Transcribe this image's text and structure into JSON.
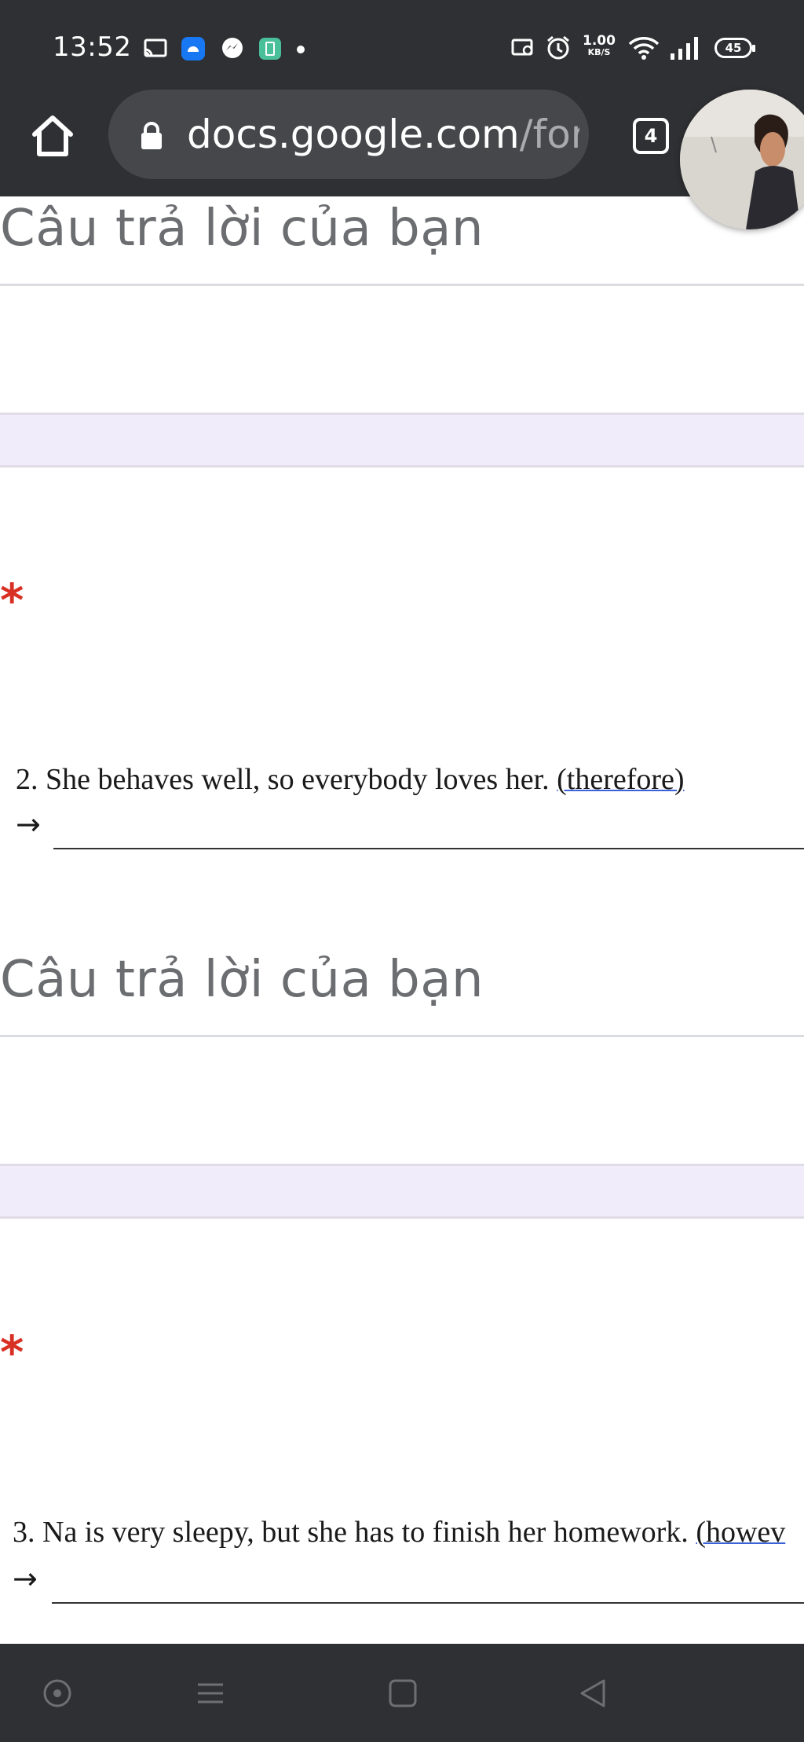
{
  "status_bar": {
    "time": "13:52",
    "net_speed_value": "1.00",
    "net_speed_unit": "KB/S",
    "battery": "45",
    "notification_icons": [
      "cast-icon",
      "app-icon",
      "messenger-icon",
      "notes-app-icon"
    ]
  },
  "browser": {
    "url_host": "docs.google.com",
    "url_path": "/for",
    "tab_count": "4"
  },
  "form": {
    "answer_placeholder": "Câu trả lời của bạn",
    "required_marker": "*",
    "arrow": "→",
    "questions": [
      {
        "text": "2. She behaves well, so everybody loves her. ",
        "hint": "(therefore)"
      },
      {
        "text": "3. Na is very sleepy, but she has to finish her homework. ",
        "hint": "(howev"
      }
    ]
  },
  "colors": {
    "system_bar": "#2f3033",
    "url_bar": "#45474b",
    "required": "#d93025",
    "divider_band": "#f1ecf9",
    "placeholder": "#6b6d70"
  }
}
